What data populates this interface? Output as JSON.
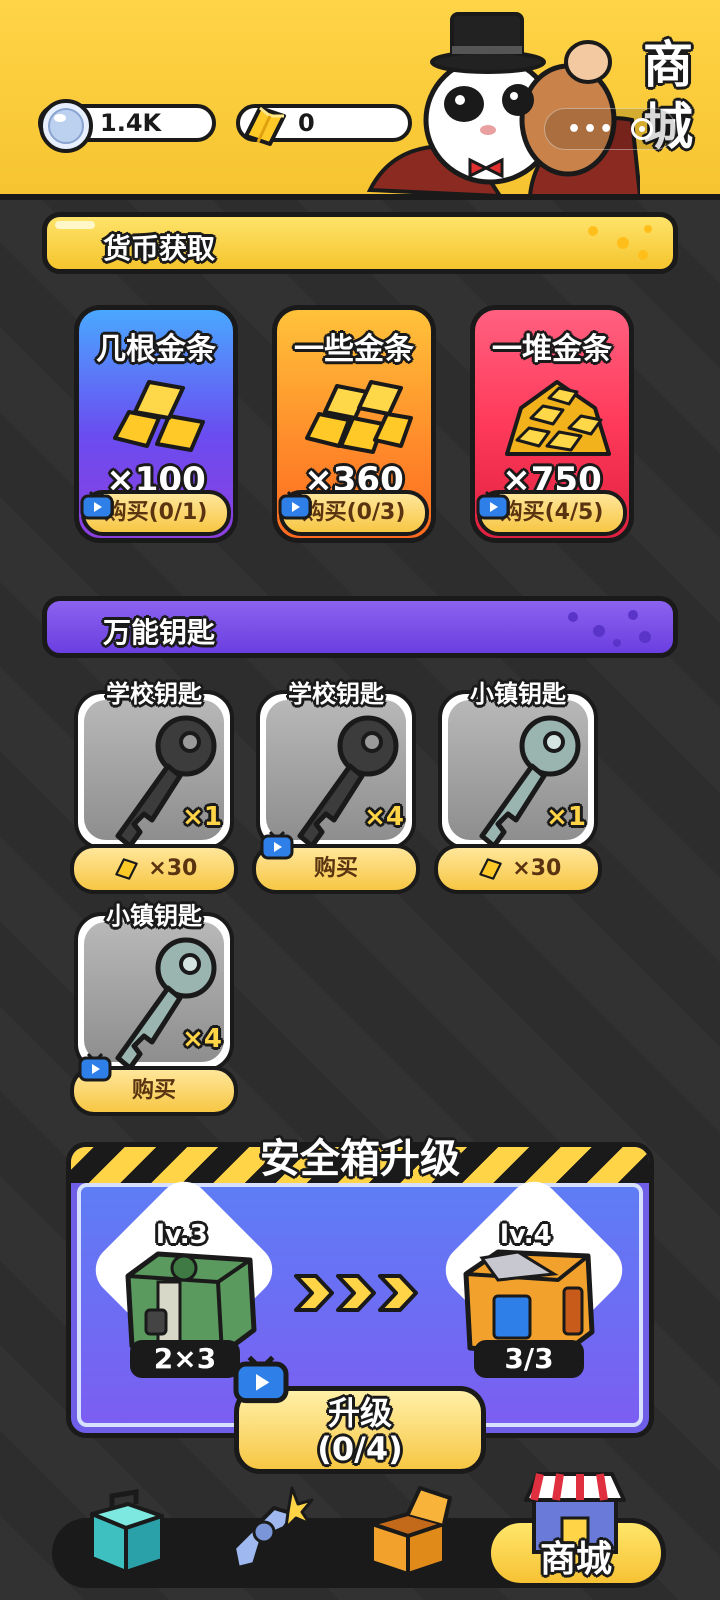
{
  "header": {
    "diamond_value": "1.4K",
    "gold_value": "0",
    "shop_title_1": "商",
    "shop_title_2": "城",
    "capsule_dots": "•••"
  },
  "sections": {
    "currency_title": "货币获取",
    "keys_title": "万能钥匙"
  },
  "currency_packs": [
    {
      "title": "几根金条",
      "amount": "×100",
      "buy": "购买(0/1)"
    },
    {
      "title": "一些金条",
      "amount": "×360",
      "buy": "购买(0/3)"
    },
    {
      "title": "一堆金条",
      "amount": "×750",
      "buy": "购买(4/5)"
    }
  ],
  "key_items": [
    {
      "title": "学校钥匙",
      "qty": "×1",
      "price": "×30",
      "price_type": "gold-bar-icon"
    },
    {
      "title": "学校钥匙",
      "qty": "×4",
      "price": "购买",
      "price_type": "video-ad-icon"
    },
    {
      "title": "小镇钥匙",
      "qty": "×1",
      "price": "×30",
      "price_type": "gold-bar-icon"
    },
    {
      "title": "小镇钥匙",
      "qty": "×4",
      "price": "购买",
      "price_type": "video-ad-icon"
    }
  ],
  "upgrade": {
    "title": "安全箱升级",
    "current_level": "lv.3",
    "current_size": "2×3",
    "next_level": "lv.4",
    "next_size": "3/3",
    "button_line1": "升级",
    "button_line2": "(0/4)"
  },
  "nav": {
    "items": [
      "toolbox-icon",
      "revolver-icon",
      "open-box-icon",
      "shop-icon"
    ],
    "shop_label": "商城"
  },
  "colors": {
    "header_yellow": "#ffd447",
    "background": "#2d2d2d",
    "key_purple": "#7a52ea",
    "upgrade_blue": "#6a6ef0"
  }
}
